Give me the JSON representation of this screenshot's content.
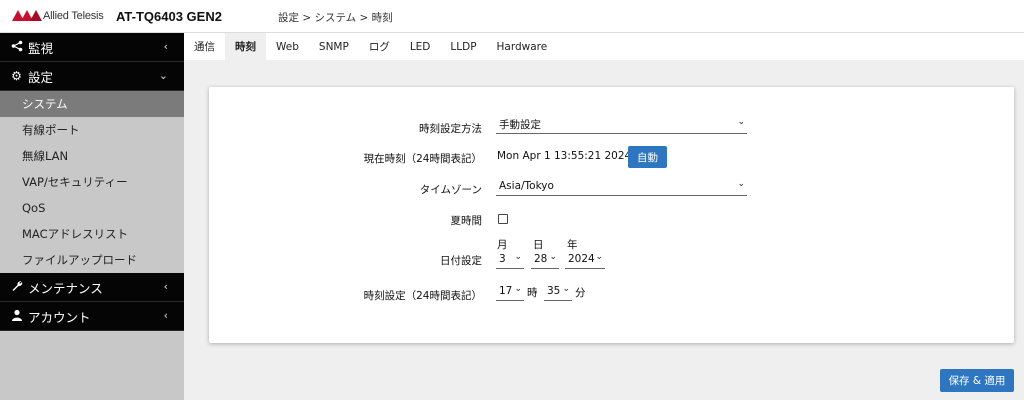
{
  "header": {
    "brand": "Allied Telesis",
    "product": "AT-TQ6403 GEN2",
    "breadcrumb": "設定 > システム > 時刻"
  },
  "sidebar": {
    "groups": [
      {
        "label": "監視",
        "icon": "share-icon"
      },
      {
        "label": "設定",
        "icon": "gear-icon"
      },
      {
        "label": "メンテナンス",
        "icon": "wrench-icon"
      },
      {
        "label": "アカウント",
        "icon": "user-icon"
      }
    ],
    "items": [
      {
        "label": "システム",
        "active": true
      },
      {
        "label": "有線ポート"
      },
      {
        "label": "無線LAN"
      },
      {
        "label": "VAP/セキュリティー"
      },
      {
        "label": "QoS"
      },
      {
        "label": "MACアドレスリスト"
      },
      {
        "label": "ファイルアップロード"
      }
    ]
  },
  "tabs": [
    {
      "label": "通信"
    },
    {
      "label": "時刻",
      "active": true
    },
    {
      "label": "Web"
    },
    {
      "label": "SNMP"
    },
    {
      "label": "ログ"
    },
    {
      "label": "LED"
    },
    {
      "label": "LLDP"
    },
    {
      "label": "Hardware"
    }
  ],
  "form": {
    "method_label": "時刻設定方法",
    "method_value": "手動設定",
    "current_label": "現在時刻（24時間表記）",
    "current_value": "Mon Apr 1 13:55:21 2024 JST",
    "auto_button": "自動",
    "tz_label": "タイムゾーン",
    "tz_value": "Asia/Tokyo",
    "dst_label": "夏時間",
    "dst_checked": false,
    "date_label": "日付設定",
    "month_label": "月",
    "day_label": "日",
    "year_label": "年",
    "month_value": "3",
    "day_value": "28",
    "year_value": "2024",
    "time_label": "時刻設定（24時間表記）",
    "hour_value": "17",
    "hour_unit": "時",
    "minute_value": "35",
    "minute_unit": "分"
  },
  "actions": {
    "save_label": "保存 & 適用"
  },
  "colors": {
    "accent": "#2e77c0",
    "brand": "#c8102e",
    "nav_group_bg": "#050505",
    "nav_active_bg": "#7b7b7b"
  }
}
